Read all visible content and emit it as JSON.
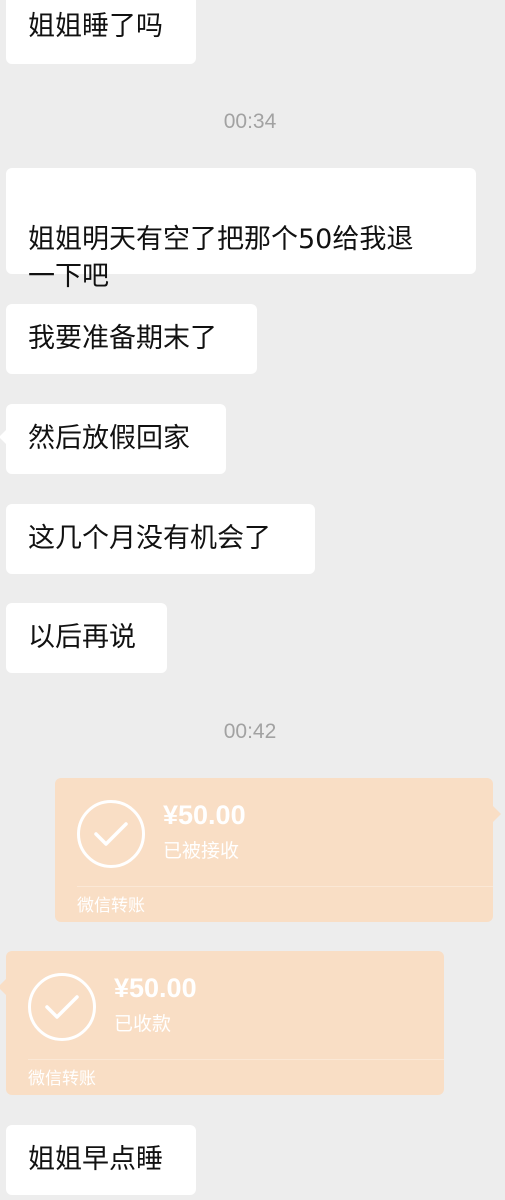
{
  "messages": [
    {
      "text": "姐姐睡了吗"
    },
    {
      "text": "姐姐明天有空了把那个50给我退\n一下吧"
    },
    {
      "text": "我要准备期末了"
    },
    {
      "text": "然后放假回家"
    },
    {
      "text": "这几个月没有机会了"
    },
    {
      "text": "以后再说"
    },
    {
      "text": "姐姐早点睡"
    }
  ],
  "timestamps": [
    "00:34",
    "00:42"
  ],
  "transfers": [
    {
      "amount": "¥50.00",
      "status": "已被接收",
      "footer": "微信转账",
      "direction": "sent"
    },
    {
      "amount": "¥50.00",
      "status": "已收款",
      "footer": "微信转账",
      "direction": "received"
    }
  ],
  "colors": {
    "background": "#ededed",
    "bubble": "#ffffff",
    "transfer_bubble": "#f9dec5",
    "timestamp_text": "#a2a2a2"
  },
  "icons": {
    "transfer_status": "check-circle-icon"
  }
}
